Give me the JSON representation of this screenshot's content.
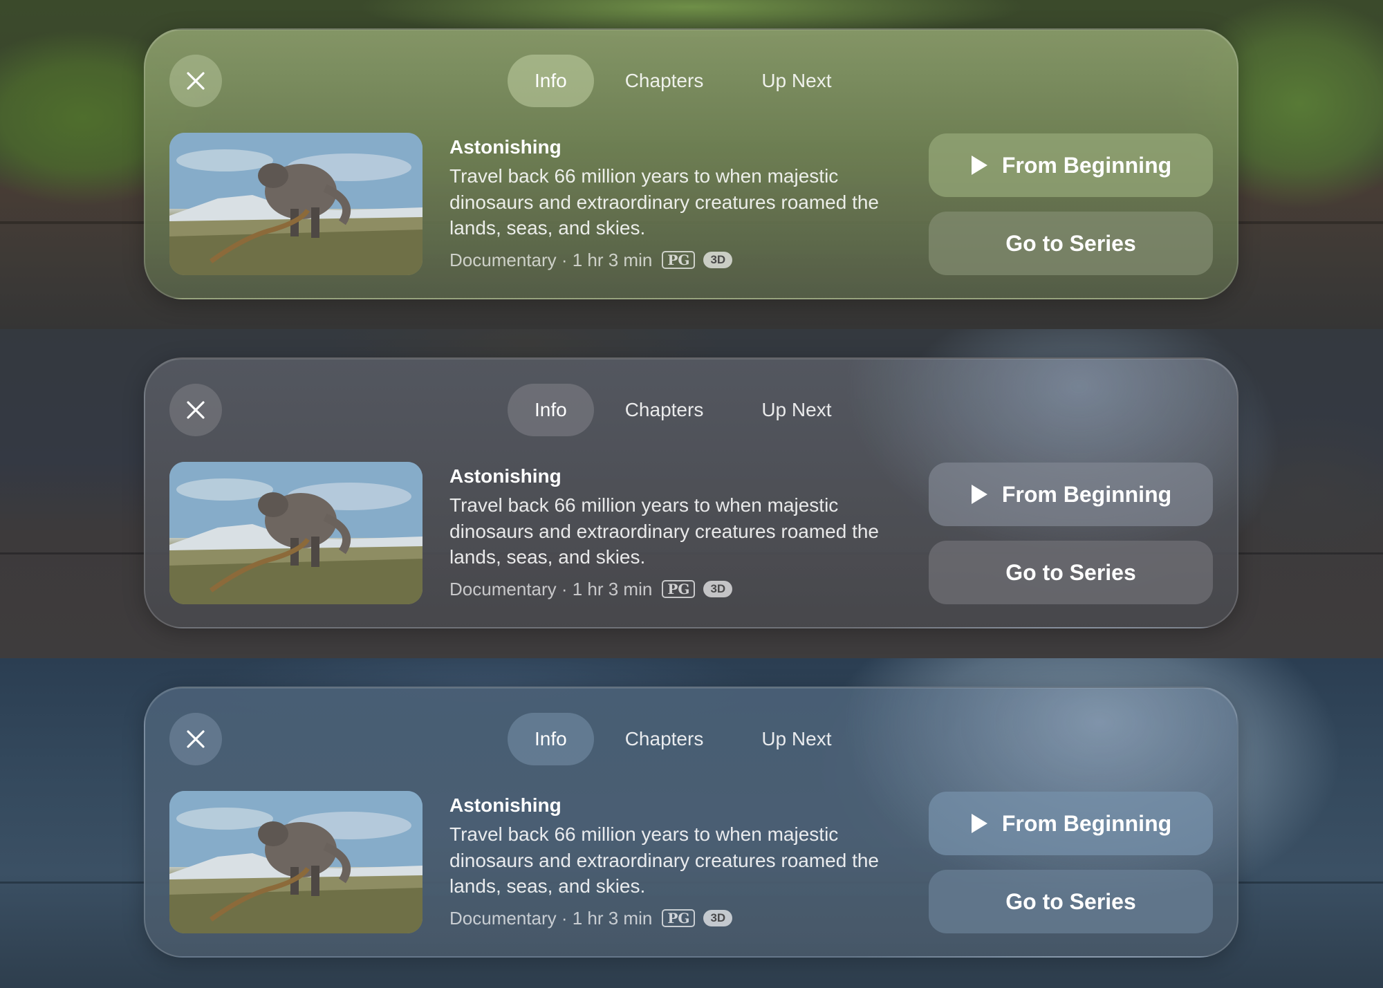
{
  "panels": [
    {
      "theme": "green",
      "tabs": [
        {
          "label": "Info",
          "active": true
        },
        {
          "label": "Chapters"
        },
        {
          "label": "Up Next"
        }
      ],
      "title": "Astonishing",
      "description": "Travel back 66 million years to when majestic dinosaurs and extraordinary creatures roamed the lands, seas, and skies.",
      "meta": "Documentary · 1 hr 3 min",
      "rating": "PG",
      "format": "3D",
      "primary_button": "From Beginning",
      "secondary_button": "Go to Series"
    },
    {
      "theme": "gray",
      "tabs": [
        {
          "label": "Info",
          "active": true
        },
        {
          "label": "Chapters"
        },
        {
          "label": "Up Next"
        }
      ],
      "title": "Astonishing",
      "description": "Travel back 66 million years to when majestic dinosaurs and extraordinary creatures roamed the lands, seas, and skies.",
      "meta": "Documentary · 1 hr 3 min",
      "rating": "PG",
      "format": "3D",
      "primary_button": "From Beginning",
      "secondary_button": "Go to Series"
    },
    {
      "theme": "blue",
      "tabs": [
        {
          "label": "Info",
          "active": true
        },
        {
          "label": "Chapters"
        },
        {
          "label": "Up Next"
        }
      ],
      "title": "Astonishing",
      "description": "Travel back 66 million years to when majestic dinosaurs and extraordinary creatures roamed the lands, seas, and skies.",
      "meta": "Documentary · 1 hr 3 min",
      "rating": "PG",
      "format": "3D",
      "primary_button": "From Beginning",
      "secondary_button": "Go to Series"
    }
  ],
  "icons": {
    "close": "close-icon",
    "play": "play-icon",
    "thumbnail": "dinosaur-thumbnail"
  },
  "colors": {
    "green_theme": "#7a8a5c",
    "gray_theme": "#5a5d64",
    "blue_theme": "#4e6680",
    "text": "#ffffff"
  }
}
